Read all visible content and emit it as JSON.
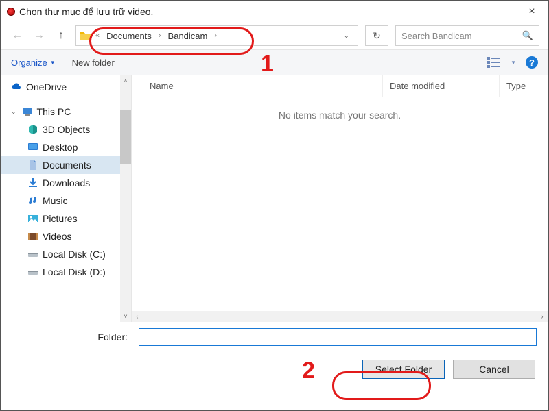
{
  "title": "Chọn thư mục để lưu trữ video.",
  "breadcrumbs": {
    "ellipsis": "«",
    "a": "Documents",
    "b": "Bandicam"
  },
  "search_placeholder": "Search Bandicam",
  "toolbar": {
    "organize": "Organize",
    "newfolder": "New folder"
  },
  "tree": {
    "onedrive": "OneDrive",
    "thispc": "This PC",
    "items": {
      "obj3d": "3D Objects",
      "desktop": "Desktop",
      "documents": "Documents",
      "downloads": "Downloads",
      "music": "Music",
      "pictures": "Pictures",
      "videos": "Videos",
      "diskc": "Local Disk (C:)",
      "diskd": "Local Disk (D:)"
    }
  },
  "columns": {
    "name": "Name",
    "date": "Date modified",
    "type": "Type"
  },
  "empty": "No items match your search.",
  "folder_label": "Folder:",
  "folder_value": "",
  "buttons": {
    "select": "Select Folder",
    "cancel": "Cancel"
  },
  "annotations": {
    "one": "1",
    "two": "2"
  }
}
